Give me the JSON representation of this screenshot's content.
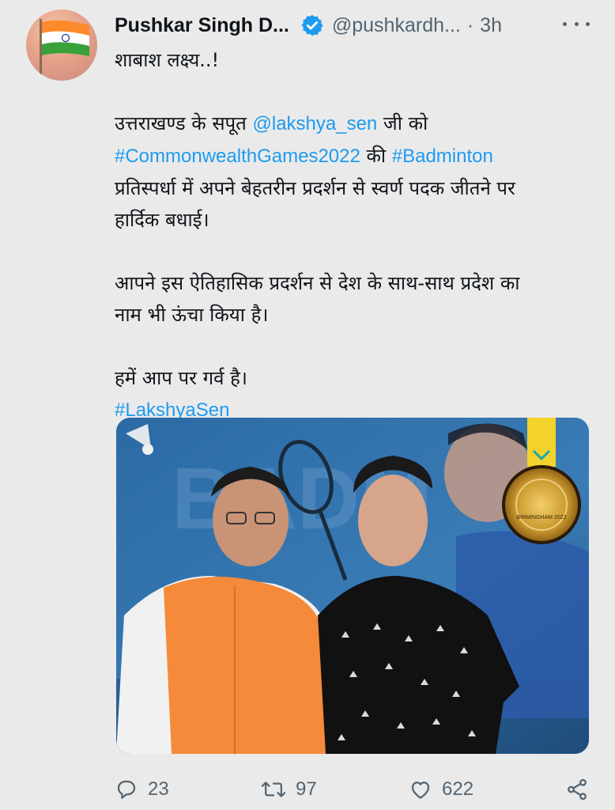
{
  "tweet": {
    "author_name": "Pushkar Singh D...",
    "handle": "@pushkardh...",
    "separator": "·",
    "time": "3h",
    "lines": {
      "l1": "शाबाश लक्ष्य..!",
      "l2_pre": "उत्तराखण्ड के सपूत ",
      "l2_mention": "@lakshya_sen",
      "l2_post": " जी को",
      "l3_hashtag1": "#CommonwealthGames2022",
      "l3_mid": " की ",
      "l3_hashtag2": "#Badminton",
      "l4": "प्रतिस्पर्धा में अपने बेहतरीन प्रदर्शन से स्वर्ण पदक जीतने पर",
      "l5": "हार्दिक बधाई।",
      "l6": "आपने इस ऐतिहासिक प्रदर्शन से देश के साथ-साथ प्रदेश का",
      "l7": "नाम भी ऊंचा किया है।",
      "l8": "हमें आप पर गर्व है।",
      "l9_hashtag": "#LakshyaSen"
    },
    "media": {
      "medal_text": "BIRMINGHAM 2022",
      "background_text": "BADM"
    },
    "actions": {
      "replies": "23",
      "retweets": "97",
      "likes": "622"
    },
    "icons": {
      "verified": "verified-badge-icon",
      "more": "more-icon",
      "reply": "reply-icon",
      "retweet": "retweet-icon",
      "like": "heart-icon",
      "share": "share-icon"
    },
    "colors": {
      "link": "#1d9bf0",
      "secondary_text": "#536471",
      "background": "#eaeaea"
    }
  }
}
